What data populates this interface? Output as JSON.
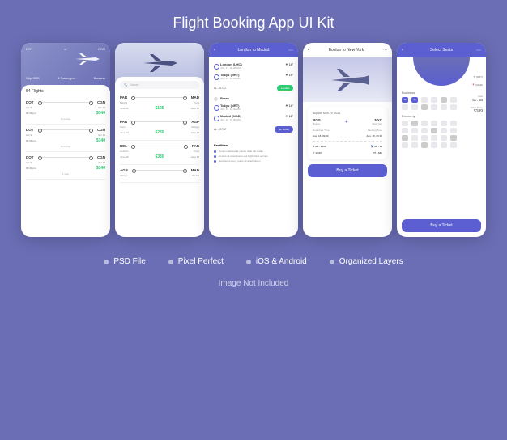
{
  "title": "Flight Booking App UI Kit",
  "features": [
    "PSD File",
    "Pixel Perfect",
    "iOS & Android",
    "Organized Layers"
  ],
  "disclaimer": "Image Not Included",
  "screen1": {
    "topbar": {
      "left": "DOT",
      "right": "CGN"
    },
    "date": "9 Apr 2021",
    "passengers_label": "1 Passengers",
    "class_label": "Business",
    "page_label": "54 Flights",
    "flights": [
      {
        "from_code": "DOT",
        "to_code": "CGN",
        "from_date": "Apr 9",
        "to_date": "Apr 10",
        "from_time": "05:30 pm",
        "to_time": "06:00 am",
        "price": "$140",
        "stop": "Non-stop"
      },
      {
        "from_code": "DOT",
        "to_code": "CGN",
        "from_date": "Apr 9",
        "to_date": "Apr 10",
        "from_time": "05:30 pm",
        "to_time": "06:00 am",
        "price": "$140",
        "stop": "Non-stop"
      },
      {
        "from_code": "DOT",
        "to_code": "CGN",
        "from_date": "Apr 9",
        "to_date": "Apr 10",
        "from_time": "05:30 pm",
        "to_time": "06:00 am",
        "price": "$140",
        "stop": "1 stop"
      }
    ]
  },
  "screen2": {
    "search_placeholder": "Search",
    "flights": [
      {
        "from_code": "PAR",
        "from_city": "Madrid",
        "to_code": "MAD",
        "to_city": "Paris",
        "from_date": "June 15",
        "to_date": "June 17",
        "price": "$125"
      },
      {
        "from_code": "PAR",
        "from_city": "Paris",
        "to_code": "AGP",
        "to_city": "Málaga",
        "from_date": "June 23",
        "to_date": "June 23",
        "price": "$230"
      },
      {
        "from_code": "HEL",
        "from_city": "Helsinki",
        "to_code": "PAR",
        "to_city": "Paris",
        "from_date": "June 25",
        "to_date": "June 27",
        "price": "$330"
      },
      {
        "from_code": "AGP",
        "from_city": "Málaga",
        "to_code": "MAD",
        "to_city": "Madrid",
        "from_date": "",
        "to_date": "",
        "price": ""
      }
    ]
  },
  "screen3": {
    "header": "London to Madrid",
    "timeline": [
      {
        "title": "London (LHC)",
        "sub": "July, 17. 08:30 AM",
        "temp": "14°"
      },
      {
        "title": "Tokyo (NRT)",
        "sub": "July, 18. 06:00 AM",
        "temp": "19°"
      }
    ],
    "flight_no": "AL - 6732",
    "status1": "Landed",
    "break_label": "Break",
    "timeline2": [
      {
        "title": "Tokyo (NRT)",
        "sub": "July, 18. 10:30 AM",
        "temp": "14°"
      },
      {
        "title": "Madrid (MAD)",
        "sub": "July, 22. 06:00 AM",
        "temp": "16°"
      }
    ],
    "flight_no2": "AL - 6732",
    "status2": "En Route",
    "facilities_label": "Facilities",
    "facilities": [
      "Donec malesuada mauris vitae elit mattis",
      "Cursus sit amet ipsum sed flight ticket service",
      "Nam fermentum, purus sit amet rutrum"
    ]
  },
  "screen4": {
    "header": "Boston to New York",
    "date_label": "August, Mon 19, 2021",
    "from_code": "BOS",
    "from_city": "Boston",
    "to_code": "NYC",
    "to_city": "New York",
    "dep_label": "Departure Time",
    "land_label": "Landing Time",
    "dep_time": "Aug, 18. 09:30",
    "land_time": "Aug, 18. 09:30",
    "flight_icon_label": "AB - 1003",
    "seat_icon_label": "2B - 39",
    "duration": "12:03",
    "meal": "4 Min",
    "cta": "Buy a Ticket"
  },
  "screen5": {
    "header": "Select Seats",
    "business_label": "Business",
    "economy_label": "Economy",
    "cols": [
      "A",
      "B",
      "C",
      "D",
      "E",
      "F"
    ],
    "from_label": "(NRT)",
    "to_label": "(MAD)",
    "seat_label": "Seat",
    "seat_val": "1A - 1B",
    "price_label": "Ticket Price",
    "price_val": "$189",
    "cta": "Buy a Ticket"
  }
}
